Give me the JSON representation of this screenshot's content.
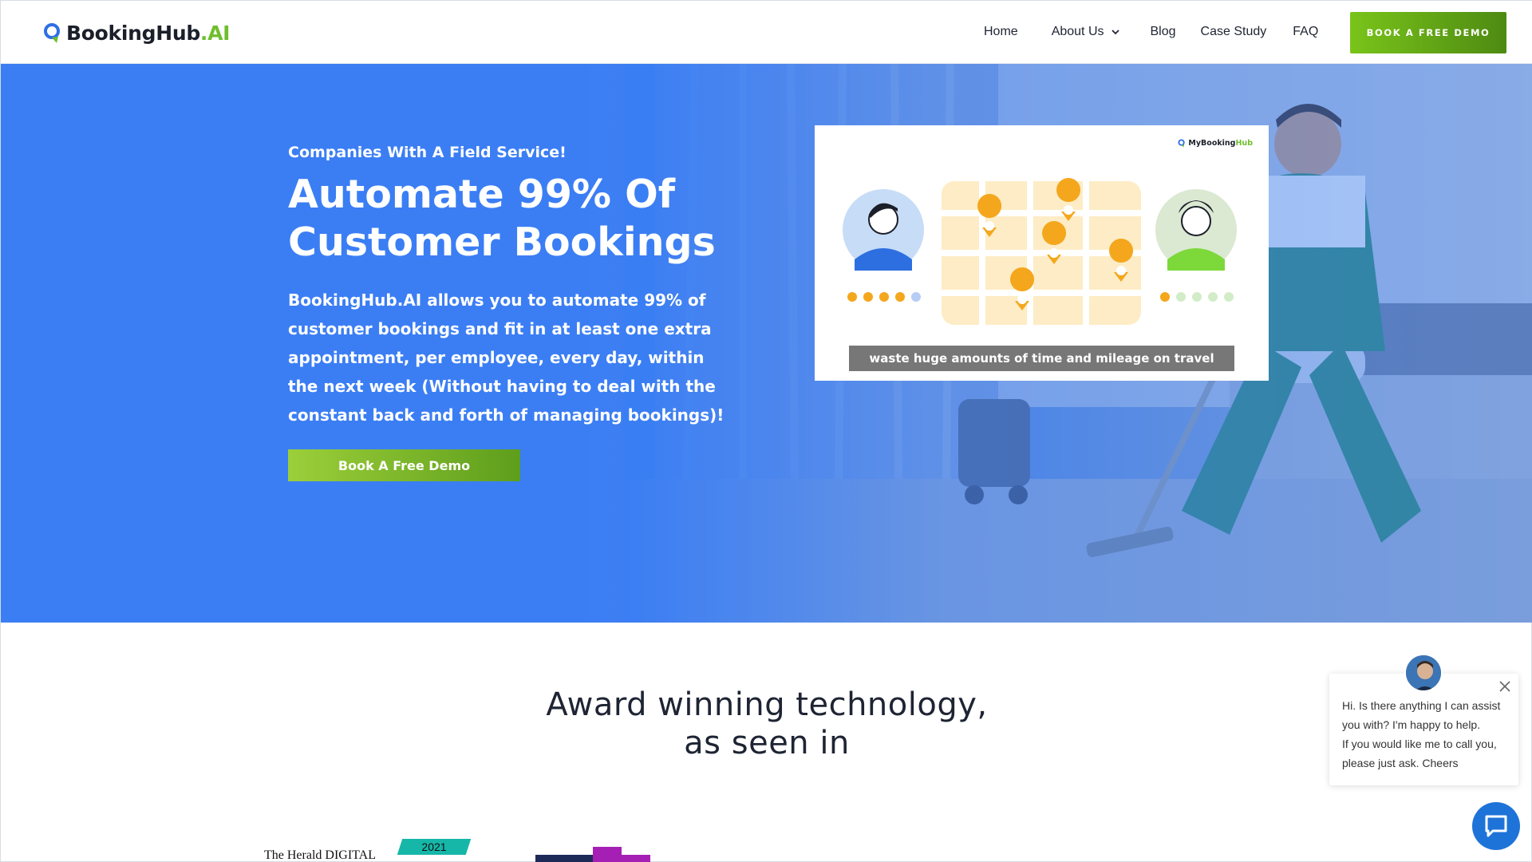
{
  "brand": {
    "name_main": "BookingHub",
    "name_ai": ".AI",
    "accent": "#6fbe2e",
    "primary": "#3b7ef4"
  },
  "nav": {
    "items": [
      "Home",
      "About Us",
      "Blog",
      "Case Study",
      "FAQ"
    ],
    "cta": "BOOK A FREE DEMO"
  },
  "hero": {
    "eyebrow": "Companies With A Field Service!",
    "title": "Automate 99% Of Customer Bookings",
    "description": "BookingHub.AI allows you to automate 99% of customer bookings and fit in at least one extra appointment, per employee, every day, within the next week (Without having to deal with the constant back and forth of managing bookings)!",
    "cta": "Book A Free Demo",
    "card": {
      "brand_main": "MyBooking",
      "brand_accent": "Hub",
      "caption": "waste huge amounts of time and mileage on travel"
    }
  },
  "awards": {
    "title_line1": "Award winning technology,",
    "title_line2": "as seen in",
    "herald_text": "The Herald DIGITAL",
    "herald_year": "2021"
  },
  "chat": {
    "message_line1": "Hi. Is there anything I can assist you with? I'm happy to help.",
    "message_line2": "If you would like me to call you, please just ask. Cheers"
  }
}
